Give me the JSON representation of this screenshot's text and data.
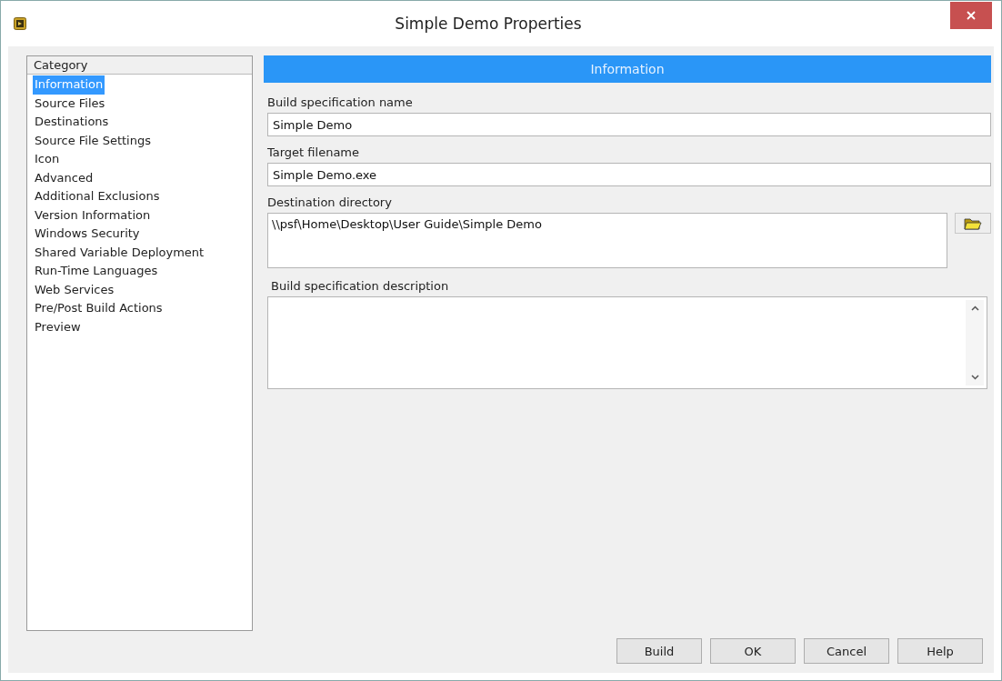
{
  "window": {
    "title": "Simple Demo Properties"
  },
  "category_list": {
    "heading": "Category",
    "items": [
      {
        "label": "Information",
        "selected": true
      },
      {
        "label": "Source Files",
        "selected": false
      },
      {
        "label": "Destinations",
        "selected": false
      },
      {
        "label": "Source File Settings",
        "selected": false
      },
      {
        "label": "Icon",
        "selected": false
      },
      {
        "label": "Advanced",
        "selected": false
      },
      {
        "label": "Additional Exclusions",
        "selected": false
      },
      {
        "label": "Version Information",
        "selected": false
      },
      {
        "label": "Windows Security",
        "selected": false
      },
      {
        "label": "Shared Variable Deployment",
        "selected": false
      },
      {
        "label": "Run-Time Languages",
        "selected": false
      },
      {
        "label": "Web Services",
        "selected": false
      },
      {
        "label": "Pre/Post Build Actions",
        "selected": false
      },
      {
        "label": "Preview",
        "selected": false
      }
    ]
  },
  "section_header": "Information",
  "fields": [
    {
      "kind": "text",
      "label": "Build specification name",
      "value": "Simple Demo"
    },
    {
      "kind": "text",
      "label": "Target filename",
      "value": "Simple Demo.exe"
    },
    {
      "kind": "path",
      "label": "Destination directory",
      "value": "\\\\psf\\Home\\Desktop\\User Guide\\Simple Demo"
    },
    {
      "kind": "textarea",
      "label": "Build specification description"
    }
  ],
  "buttons": [
    "Build",
    "OK",
    "Cancel",
    "Help"
  ]
}
